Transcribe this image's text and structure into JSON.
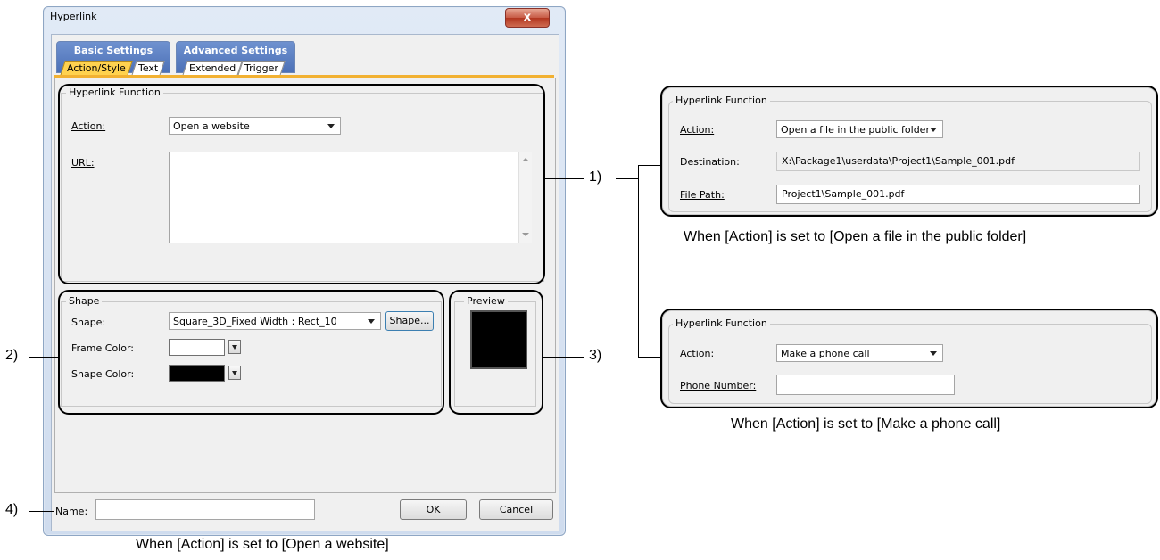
{
  "dialog": {
    "title": "Hyperlink",
    "close_label": "x",
    "tab_groups": [
      {
        "label": "Basic Settings",
        "tabs": [
          "Action/Style",
          "Text"
        ]
      },
      {
        "label": "Advanced Settings",
        "tabs": [
          "Extended",
          "Trigger"
        ]
      }
    ],
    "hyperlink_function": {
      "legend": "Hyperlink Function",
      "action_label": "Action:",
      "action_value": "Open a website",
      "url_label": "URL:",
      "url_value": ""
    },
    "shape_group": {
      "legend": "Shape",
      "shape_label": "Shape:",
      "shape_value": "Square_3D_Fixed Width : Rect_10",
      "shape_button": "Shape...",
      "frame_color_label": "Frame Color:",
      "shape_color_label": "Shape Color:"
    },
    "preview": {
      "legend": "Preview"
    },
    "name_label": "Name:",
    "name_value": "",
    "ok_label": "OK",
    "cancel_label": "Cancel"
  },
  "colors": {
    "frame_color": "#ffffff",
    "shape_color": "#000000",
    "preview_fill": "#000000",
    "active_tab": "#ffd24f",
    "tab_group": "#5a7cc0"
  },
  "markers": {
    "m1": "1)",
    "m2": "2)",
    "m3": "3)",
    "m4": "4)"
  },
  "panel_public_folder": {
    "legend": "Hyperlink Function",
    "action_label": "Action:",
    "action_value": "Open a file in the public folder",
    "destination_label": "Destination:",
    "destination_value": "X:\\Package1\\userdata\\Project1\\Sample_001.pdf",
    "file_path_label": "File Path:",
    "file_path_value": "Project1\\Sample_001.pdf",
    "caption": "When [Action] is set to [Open a file in the public folder]"
  },
  "panel_phone": {
    "legend": "Hyperlink Function",
    "action_label": "Action:",
    "action_value": "Make a phone call",
    "phone_label": "Phone Number:",
    "phone_value": "",
    "caption": "When [Action] is set to [Make a phone call]"
  },
  "caption_main": "When [Action] is set to [Open a website]"
}
